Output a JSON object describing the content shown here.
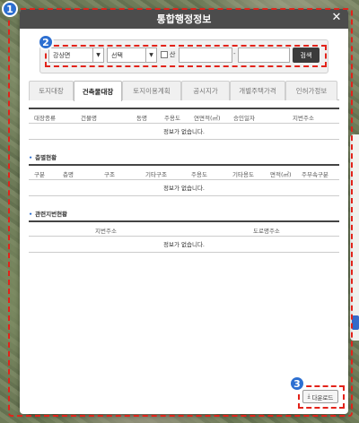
{
  "badges": [
    "1",
    "2",
    "3"
  ],
  "window": {
    "title": "통합행정정보",
    "close_glyph": "✕"
  },
  "search": {
    "region_value": "강상면",
    "lot_value": "선택",
    "mountain_label": "산",
    "main_number": "",
    "sub_number": "",
    "separator": "-",
    "button_label": "검색"
  },
  "tabs": [
    {
      "label": "토지대장",
      "active": false
    },
    {
      "label": "건축물대장",
      "active": true
    },
    {
      "label": "토지이용계획",
      "active": false
    },
    {
      "label": "공시지가",
      "active": false
    },
    {
      "label": "개별주택가격",
      "active": false
    },
    {
      "label": "인허가정보",
      "active": false
    }
  ],
  "building_table": {
    "headers": [
      "대장종류",
      "건물명",
      "동명",
      "주용도",
      "연면적(㎡)",
      "승인일자",
      "지번주소"
    ],
    "empty_message": "정보가 없습니다."
  },
  "floor_section": {
    "title": "층별현황",
    "headers": [
      "구분",
      "층명",
      "구조",
      "기타구조",
      "주용도",
      "기타용도",
      "면적(㎡)",
      "주부속구분"
    ],
    "empty_message": "정보가 없습니다."
  },
  "related_section": {
    "title": "관련지번현황",
    "headers": [
      "지번주소",
      "도로명주소"
    ],
    "empty_message": "정보가 없습니다."
  },
  "download": {
    "label": "다운로드",
    "icon": "download-icon"
  },
  "colors": {
    "title_bar": "#4c4c4c",
    "badge": "#2d6fd1",
    "annotation": "#e2231a",
    "search_button": "#3b3b3b"
  }
}
